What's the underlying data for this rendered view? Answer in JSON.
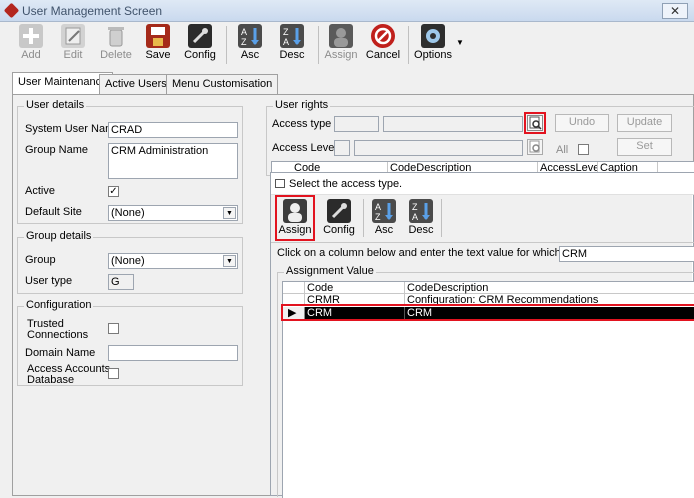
{
  "window": {
    "title": "User Management Screen",
    "close": "✕"
  },
  "toolbar": {
    "add": "Add",
    "edit": "Edit",
    "delete": "Delete",
    "save": "Save",
    "config": "Config",
    "asc": "Asc",
    "desc": "Desc",
    "assign": "Assign",
    "cancel": "Cancel",
    "options": "Options"
  },
  "tabs": [
    "User Maintenance",
    "Active Users",
    "Menu Customisation"
  ],
  "user_details": {
    "legend": "User details",
    "system_user_name_label": "System User Name",
    "system_user_name": "CRAD",
    "group_name_label": "Group Name",
    "group_name": "CRM Administration",
    "active_label": "Active",
    "active_check": "✓",
    "default_site_label": "Default Site",
    "default_site": "(None)"
  },
  "group_details": {
    "legend": "Group details",
    "group_label": "Group",
    "group": "(None)",
    "user_type_label": "User type",
    "user_type": "G"
  },
  "configuration": {
    "legend": "Configuration",
    "trusted_label_1": "Trusted",
    "trusted_label_2": "Connections",
    "domain_label": "Domain Name",
    "access_label_1": "Access Accounts",
    "access_label_2": "Database"
  },
  "user_rights": {
    "legend": "User rights",
    "access_type_label": "Access type",
    "access_level_label": "Access Level",
    "all_label": "All",
    "undo": "Undo",
    "update": "Update",
    "set": "Set",
    "columns": [
      "Code",
      "CodeDescription",
      "AccessLevel",
      "Caption"
    ]
  },
  "dialog": {
    "title": "Select the access type.",
    "assign": "Assign",
    "config": "Config",
    "asc": "Asc",
    "desc": "Desc",
    "filter_label": "Click on a column below and enter the text value for which to filter :",
    "filter_value": "CRM",
    "group_label": "Assignment Value",
    "columns": [
      "Code",
      "CodeDescription"
    ],
    "rows": [
      {
        "code": "CRMR",
        "desc": "Configuration: CRM Recommendations"
      },
      {
        "code": "CRM",
        "desc": "CRM"
      }
    ]
  },
  "colors": {
    "highlight": "#e2131f",
    "selected_row": "#000000"
  }
}
